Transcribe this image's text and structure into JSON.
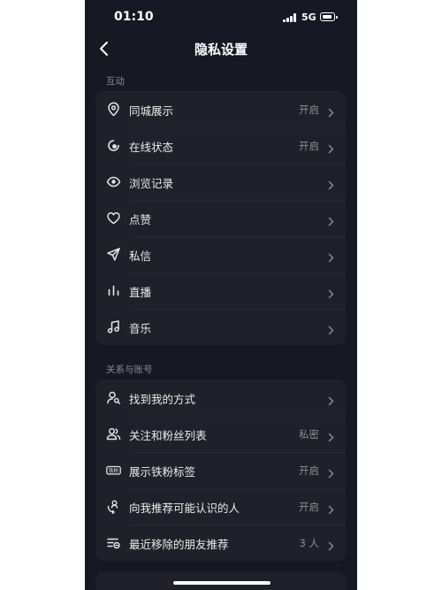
{
  "status_bar": {
    "time": "01:10",
    "network": "5G"
  },
  "nav": {
    "title": "隐私设置"
  },
  "sections": [
    {
      "label": "互动",
      "items": [
        {
          "icon": "location-pin-icon",
          "label": "同城展示",
          "value": "开启"
        },
        {
          "icon": "online-status-icon",
          "label": "在线状态",
          "value": "开启"
        },
        {
          "icon": "eye-icon",
          "label": "浏览记录",
          "value": ""
        },
        {
          "icon": "heart-icon",
          "label": "点赞",
          "value": ""
        },
        {
          "icon": "send-icon",
          "label": "私信",
          "value": ""
        },
        {
          "icon": "live-bars-icon",
          "label": "直播",
          "value": ""
        },
        {
          "icon": "music-note-icon",
          "label": "音乐",
          "value": ""
        }
      ]
    },
    {
      "label": "关系与账号",
      "items": [
        {
          "icon": "user-search-icon",
          "label": "找到我的方式",
          "value": ""
        },
        {
          "icon": "users-icon",
          "label": "关注和粉丝列表",
          "value": "私密"
        },
        {
          "icon": "fan-badge-icon",
          "label": "展示铁粉标签",
          "value": "开启"
        },
        {
          "icon": "recommend-people-icon",
          "label": "向我推荐可能认识的人",
          "value": "开启"
        },
        {
          "icon": "removed-list-icon",
          "label": "最近移除的朋友推荐",
          "value": "3 人"
        }
      ]
    }
  ],
  "badge_text": "铁粉",
  "colors": {
    "background": "#161823",
    "card": "#1f2029",
    "secondary_text": "#8b8c92"
  }
}
